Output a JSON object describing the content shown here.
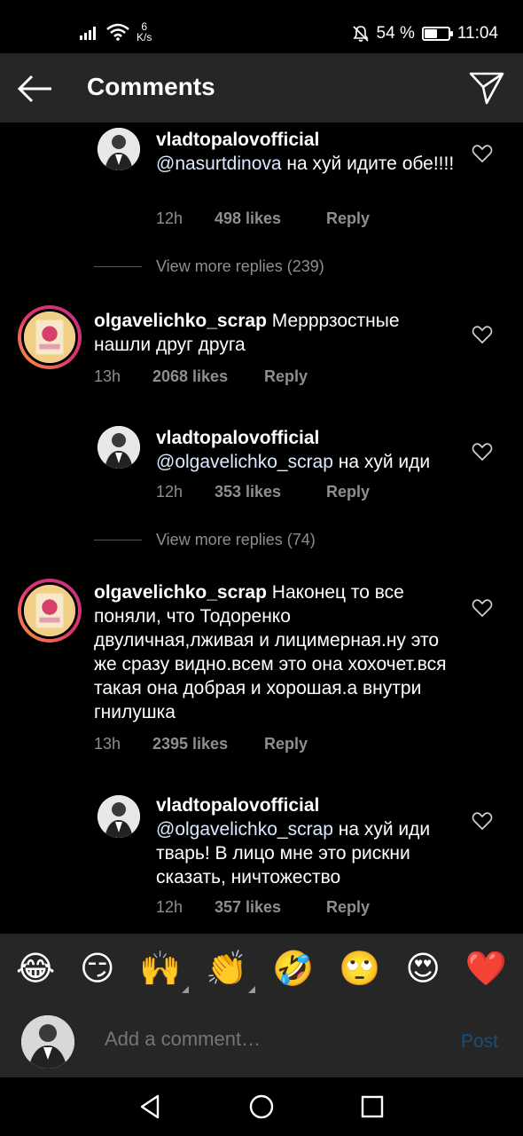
{
  "status_bar": {
    "speed_value": "6",
    "speed_unit": "K/s",
    "battery": "54 %",
    "battery_level": 0.54,
    "time": "11:04"
  },
  "header": {
    "title": "Comments"
  },
  "comments": [
    {
      "username": "vladtopalovofficial",
      "mention": "@nasurtdinova",
      "text": " на хуй идите обе!!!!",
      "time": "12h",
      "likes": "498 likes",
      "reply": "Reply"
    },
    {
      "username": "olgavelichko_scrap",
      "mention": "",
      "text": " Мерррзостные нашли друг друга",
      "time": "13h",
      "likes": "2068 likes",
      "reply": "Reply"
    },
    {
      "username": "vladtopalovofficial",
      "mention": "@olgavelichko_scrap",
      "text": " на хуй иди",
      "time": "12h",
      "likes": "353 likes",
      "reply": "Reply"
    },
    {
      "username": "olgavelichko_scrap",
      "mention": "",
      "text": " Наконец то все поняли, что  Тодоренко двуличная,лживая и лицимерная.ну это же сразу видно.всем это она хохочет.вся такая она добрая и хорошая.а внутри гнилушка",
      "time": "13h",
      "likes": "2395 likes",
      "reply": "Reply"
    },
    {
      "username": "vladtopalovofficial",
      "mention": "@olgavelichko_scrap",
      "text": " на хуй иди тварь! В лицо мне это рискни сказать, ничтожество",
      "time": "12h",
      "likes": "357 likes",
      "reply": "Reply"
    }
  ],
  "view_more": [
    "View more replies (239)",
    "View more replies (74)"
  ],
  "emojis": [
    "😂",
    "😏",
    "🙌",
    "👏",
    "🤣",
    "🙄",
    "😍",
    "❤️"
  ],
  "comment_input": {
    "placeholder": "Add a comment…",
    "post_label": "Post"
  },
  "colors": {
    "background": "#000000",
    "header": "#262626",
    "meta_text": "#8e8e8e",
    "post_disabled": "#1d4e7a"
  }
}
